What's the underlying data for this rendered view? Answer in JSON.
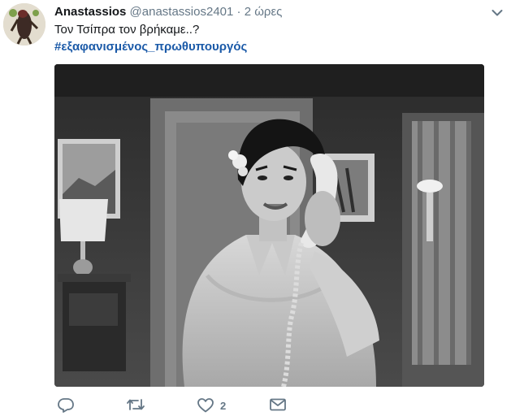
{
  "tweet": {
    "author_name": "Anastassios",
    "handle": "@anastassios2401",
    "separator": "·",
    "time": "2 ώρες",
    "text": "Τον Τσίπρα τον βρήκαμε..?",
    "hashtag": "#εξαφανισμένος_πρωθυπουργός"
  },
  "actions": {
    "reply_icon": "reply-icon",
    "retweet_icon": "retweet-icon",
    "like_icon": "heart-icon",
    "like_count": "2",
    "dm_icon": "envelope-icon"
  },
  "colors": {
    "hashtag": "#1b5aa8",
    "secondary_text": "#657786",
    "icon": "#657786"
  }
}
